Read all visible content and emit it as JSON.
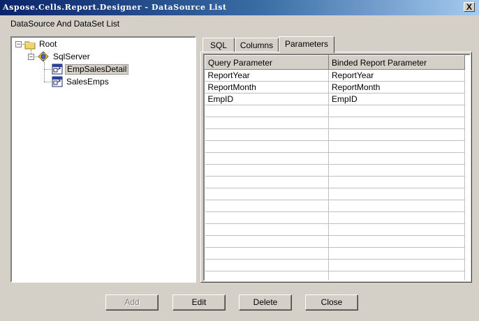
{
  "window": {
    "title": "Aspose.Cells.Report.Designer - DataSource List",
    "close_label": "X"
  },
  "section_label": "DataSource And DataSet List",
  "tree": {
    "root": {
      "label": "Root",
      "expander": "−"
    },
    "datasource": {
      "label": "SqlServer",
      "expander": "−"
    },
    "datasets": [
      {
        "label": "EmpSalesDetail",
        "selected": true
      },
      {
        "label": "SalesEmps",
        "selected": false
      }
    ]
  },
  "tabs": [
    {
      "label": "SQL",
      "active": false
    },
    {
      "label": "Columns",
      "active": false
    },
    {
      "label": "Parameters",
      "active": true
    }
  ],
  "grid": {
    "columns": [
      "Query Parameter",
      "Binded Report Parameter"
    ],
    "rows": [
      [
        "ReportYear",
        "ReportYear"
      ],
      [
        "ReportMonth",
        "ReportMonth"
      ],
      [
        "EmpID",
        "EmpID"
      ]
    ],
    "empty_rows": 15
  },
  "buttons": {
    "add": {
      "label": "Add",
      "enabled": false
    },
    "edit": {
      "label": "Edit",
      "enabled": true
    },
    "delete": {
      "label": "Delete",
      "enabled": true
    },
    "close": {
      "label": "Close",
      "enabled": true
    }
  },
  "colors": {
    "title_gradient_start": "#0a246a",
    "title_gradient_end": "#a6caf0",
    "face": "#d4d0c8",
    "folder": "#f3d46b"
  }
}
